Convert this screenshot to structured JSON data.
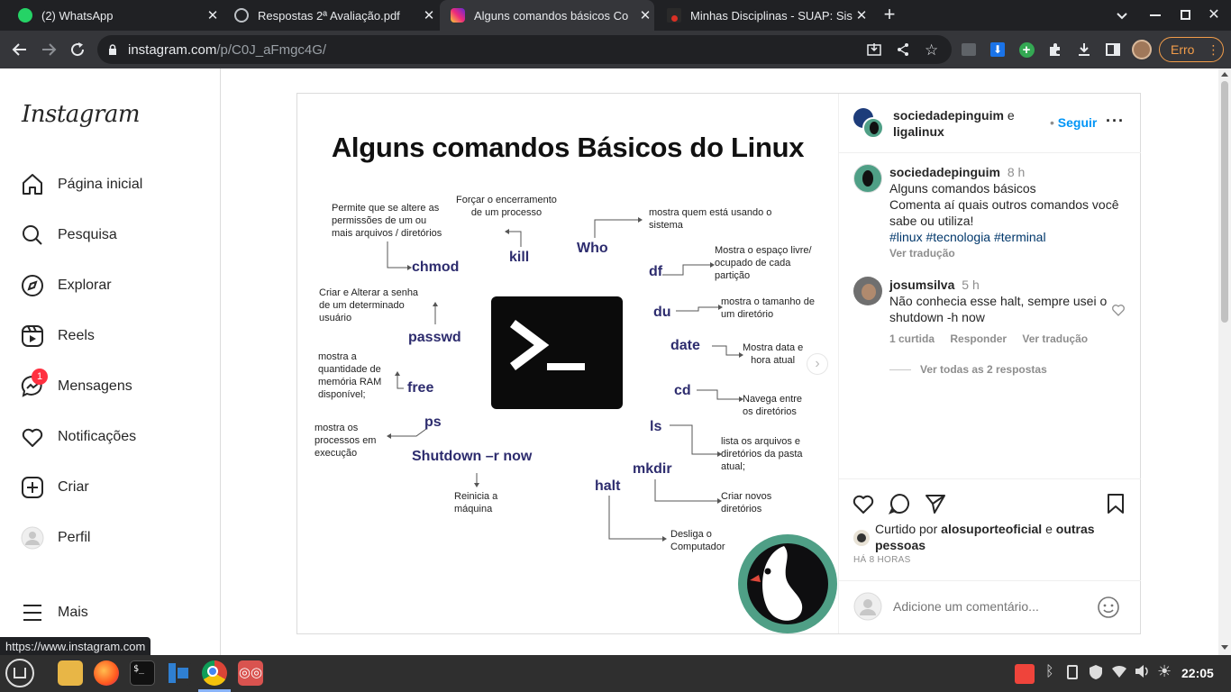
{
  "browser": {
    "tabs": [
      {
        "title": "(2) WhatsApp"
      },
      {
        "title": "Respostas 2ª Avaliação.pdf"
      },
      {
        "title": "Alguns comandos básicos Co"
      },
      {
        "title": "Minhas Disciplinas - SUAP: Sis"
      }
    ],
    "new_tab": "+",
    "url_host": "instagram.com",
    "url_path": "/p/C0J_aFmgc4G/",
    "profile_error": "Erro",
    "status_url": "https://www.instagram.com"
  },
  "sidebar": {
    "logo": "Instagram",
    "items": [
      {
        "label": "Página inicial",
        "icon": "home-icon"
      },
      {
        "label": "Pesquisa",
        "icon": "search-icon"
      },
      {
        "label": "Explorar",
        "icon": "compass-icon"
      },
      {
        "label": "Reels",
        "icon": "reels-icon"
      },
      {
        "label": "Mensagens",
        "icon": "messenger-icon",
        "badge": "1"
      },
      {
        "label": "Notificações",
        "icon": "heart-icon"
      },
      {
        "label": "Criar",
        "icon": "plus-square-icon"
      },
      {
        "label": "Perfil",
        "icon": "avatar"
      }
    ],
    "more": "Mais"
  },
  "image": {
    "title": "Alguns comandos Básicos do Linux",
    "commands": {
      "chmod": "chmod",
      "kill": "kill",
      "who": "Who",
      "df": "df",
      "passwd": "passwd",
      "du": "du",
      "date": "date",
      "free": "free",
      "cd": "cd",
      "ps": "ps",
      "ls": "ls",
      "shutdown": "Shutdown –r now",
      "mkdir": "mkdir",
      "halt": "halt"
    },
    "notes": {
      "chmod_1": "Permite que se altere as",
      "chmod_2": "permissões de um ou",
      "chmod_3": "mais arquivos / diretórios",
      "kill_1": "Forçar o encerramento",
      "kill_2": "de um processo",
      "who_1": "mostra quem está usando o",
      "who_2": "sistema",
      "df_1": "Mostra o espaço livre/",
      "df_2": "ocupado de cada",
      "df_3": "partição",
      "passwd_1": "Criar e Alterar a senha",
      "passwd_2": "de um determinado",
      "passwd_3": "usuário",
      "du_1": "mostra o tamanho de",
      "du_2": "um diretório",
      "date_1": "Mostra data e",
      "date_2": "hora atual",
      "free_1": "mostra a",
      "free_2": "quantidade de",
      "free_3": "memória RAM",
      "free_4": "disponível;",
      "cd_1": "Navega entre",
      "cd_2": "os diretórios",
      "ps_1": "mostra os",
      "ps_2": "processos em",
      "ps_3": "execução",
      "ls_1": "lista os arquivos e",
      "ls_2": "diretórios da pasta",
      "ls_3": "atual;",
      "shutdown_1": "Reinicia a",
      "shutdown_2": "máquina",
      "mkdir_1": "Criar novos",
      "mkdir_2": "diretórios",
      "halt_1": "Desliga o",
      "halt_2": "Computador"
    }
  },
  "post": {
    "header_user1": "sociedadepinguim",
    "header_and": "e",
    "header_user2": "ligalinux",
    "follow": "Seguir",
    "caption_user": "sociedadepinguim",
    "caption_time": "8 h",
    "caption_line1": "Alguns comandos básicos",
    "caption_line2": "Comenta aí quais outros comandos você sabe ou utiliza!",
    "hashtags": [
      "#linux",
      "#tecnologia",
      "#terminal"
    ],
    "see_translation": "Ver tradução",
    "comment_user": "josumsilva",
    "comment_time": "5 h",
    "comment_text": "Não conhecia esse halt, sempre usei o shutdown -h now",
    "comment_likes": "1 curtida",
    "comment_reply": "Responder",
    "comment_translate": "Ver tradução",
    "view_replies": "Ver todas as 2 respostas",
    "liked_prefix": "Curtido por",
    "liked_user": "alosuporteoficial",
    "liked_and": "e",
    "liked_others": "outras pessoas",
    "time_ago": "HÁ 8 HORAS",
    "add_comment_placeholder": "Adicione um comentário..."
  },
  "taskbar": {
    "clock": "22:05"
  },
  "colors": {
    "chrome_bg": "#202124",
    "toolbar_bg": "#35363a",
    "ig_blue": "#0095f6",
    "command_color": "#2d2c6e",
    "badge_red": "#ff3040",
    "error_orange": "#f29d4a"
  }
}
